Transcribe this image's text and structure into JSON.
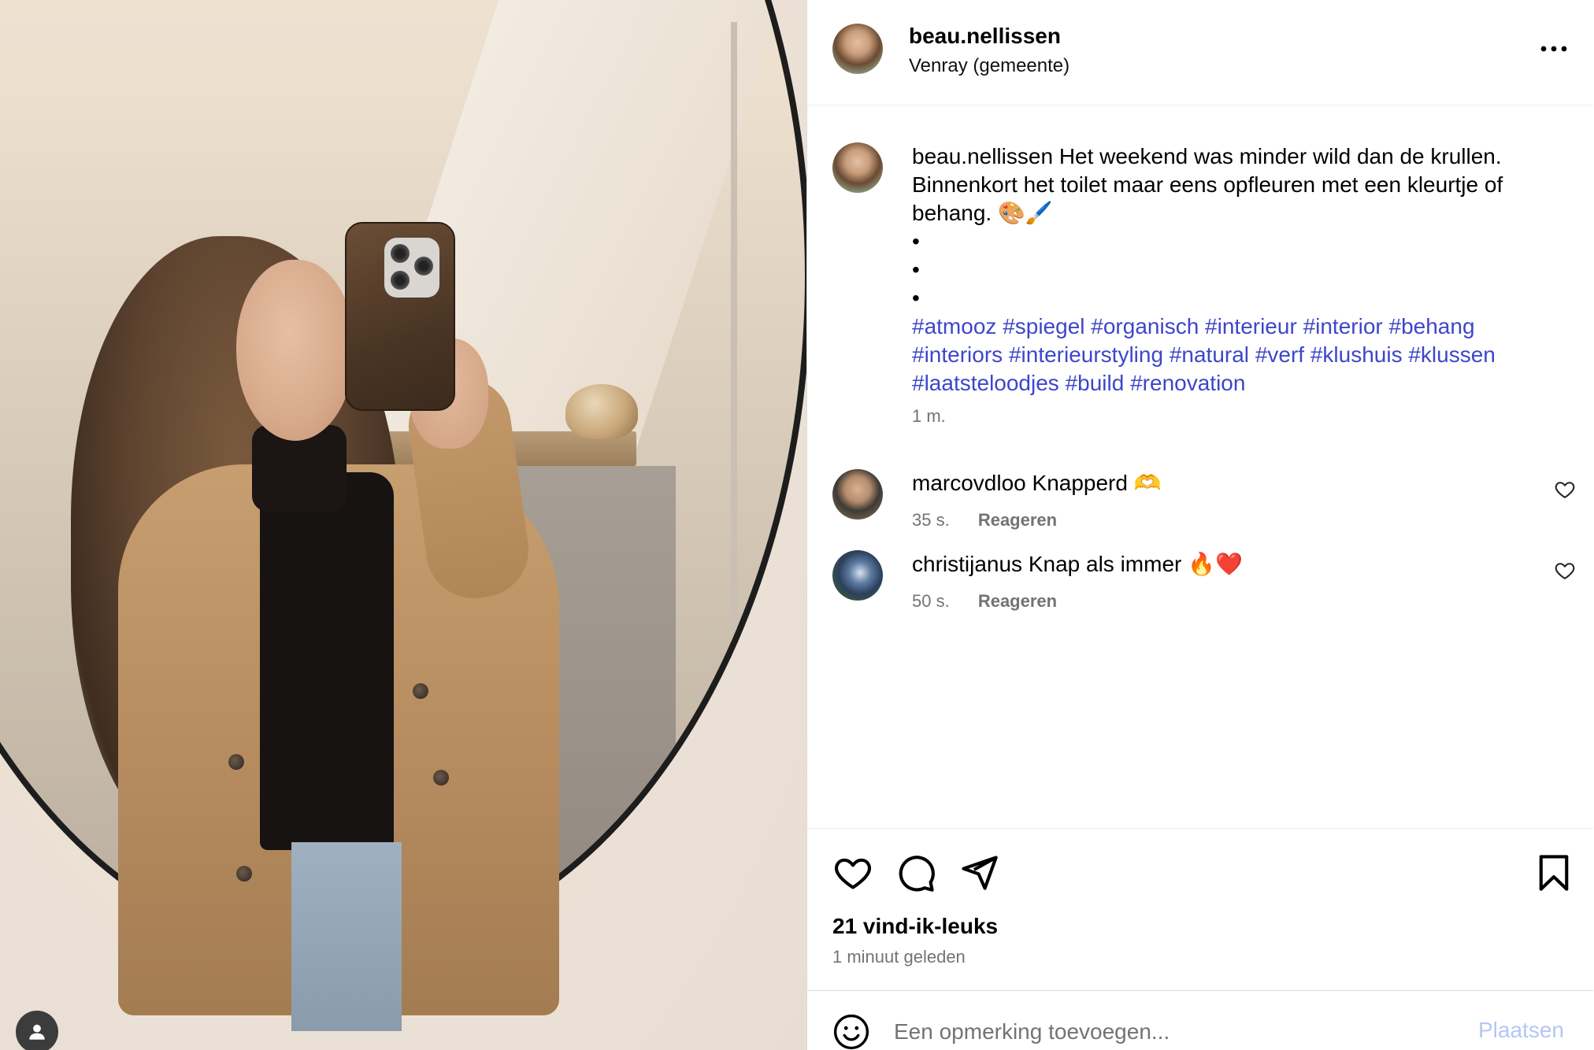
{
  "post": {
    "username": "beau.nellissen",
    "location": "Venray (gemeente)"
  },
  "caption": {
    "username": "beau.nellissen",
    "text": "Het weekend was minder wild dan de krullen. Binnenkort het toilet maar eens opfleuren met een kleurtje of behang. 🎨🖌️",
    "dots": [
      "•",
      "•",
      "•"
    ],
    "hashtags": [
      "#atmooz",
      "#spiegel",
      "#organisch",
      "#interieur",
      "#interior",
      "#behang",
      "#interiors",
      "#interieurstyling",
      "#natural",
      "#verf",
      "#klushuis",
      "#klussen",
      "#laatsteloodjes",
      "#build",
      "#renovation"
    ],
    "time": "1 m."
  },
  "comments": [
    {
      "username": "marcovdloo",
      "text": "Knapperd 🫶",
      "time": "35 s.",
      "reply_label": "Reageren"
    },
    {
      "username": "christijanus",
      "text": "Knap als immer 🔥❤️",
      "time": "50 s.",
      "reply_label": "Reageren"
    }
  ],
  "footer": {
    "likes": "21 vind-ik-leuks",
    "posted": "1 minuut geleden"
  },
  "add_comment": {
    "placeholder": "Een opmerking toevoegen...",
    "post_label": "Plaatsen"
  },
  "colors": {
    "hashtag": "#3d46c9",
    "post_button_disabled": "#b3c7f5",
    "secondary_text": "#737373"
  },
  "icons": {
    "more": "more-horizontal-icon",
    "like": "heart-icon",
    "comment": "comment-icon",
    "share": "share-icon",
    "save": "bookmark-icon",
    "emoji": "emoji-icon",
    "comment_like": "heart-icon"
  }
}
